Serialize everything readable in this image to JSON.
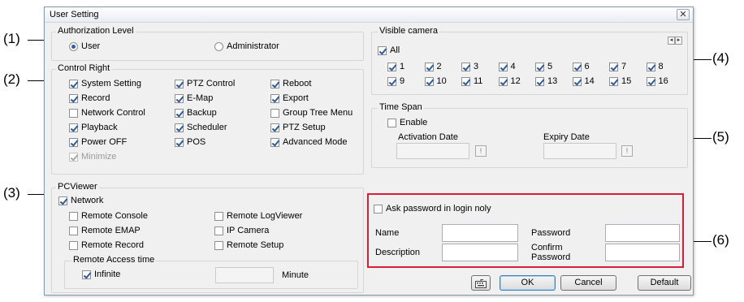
{
  "callouts": [
    "(1)",
    "(2)",
    "(3)",
    "(4)",
    "(5)",
    "(6)"
  ],
  "dialog": {
    "title": "User Setting",
    "close_glyph": "✕"
  },
  "authorization": {
    "label": "Authorization Level",
    "options": [
      {
        "label": "User",
        "selected": true
      },
      {
        "label": "Administrator",
        "selected": false
      }
    ]
  },
  "control_right": {
    "label": "Control Right",
    "items": [
      {
        "label": "System Setting",
        "checked": true,
        "disabled": false
      },
      {
        "label": "PTZ Control",
        "checked": true,
        "disabled": false
      },
      {
        "label": "Reboot",
        "checked": true,
        "disabled": false
      },
      {
        "label": "Record",
        "checked": true,
        "disabled": false
      },
      {
        "label": "E-Map",
        "checked": true,
        "disabled": false
      },
      {
        "label": "Export",
        "checked": true,
        "disabled": false
      },
      {
        "label": "Network Control",
        "checked": false,
        "disabled": false
      },
      {
        "label": "Backup",
        "checked": true,
        "disabled": false
      },
      {
        "label": "Group Tree Menu",
        "checked": false,
        "disabled": false
      },
      {
        "label": "Playback",
        "checked": true,
        "disabled": false
      },
      {
        "label": "Scheduler",
        "checked": true,
        "disabled": false
      },
      {
        "label": "PTZ Setup",
        "checked": true,
        "disabled": false
      },
      {
        "label": "Power OFF",
        "checked": true,
        "disabled": false
      },
      {
        "label": "POS",
        "checked": true,
        "disabled": false
      },
      {
        "label": "Advanced Mode",
        "checked": true,
        "disabled": false
      },
      {
        "label": "Minimize",
        "checked": true,
        "disabled": true
      }
    ]
  },
  "pcviewer": {
    "label": "PCViewer",
    "network": {
      "label": "Network",
      "checked": true
    },
    "items": [
      {
        "label": "Remote Console",
        "checked": false
      },
      {
        "label": "Remote LogViewer",
        "checked": false
      },
      {
        "label": "Remote EMAP",
        "checked": false
      },
      {
        "label": "IP Camera",
        "checked": false
      },
      {
        "label": "Remote Record",
        "checked": false
      },
      {
        "label": "Remote Setup",
        "checked": false
      }
    ],
    "access_time": {
      "label": "Remote Access time",
      "infinite_label": "Infinite",
      "infinite_checked": true,
      "minutes_value": "",
      "unit": "Minute"
    }
  },
  "visible_camera": {
    "label": "Visible camera",
    "all_label": "All",
    "all_checked": true,
    "prev_glyph": "◂",
    "next_glyph": "▸",
    "cameras": [
      "1",
      "2",
      "3",
      "4",
      "5",
      "6",
      "7",
      "8",
      "9",
      "10",
      "11",
      "12",
      "13",
      "14",
      "15",
      "16"
    ]
  },
  "time_span": {
    "label": "Time Span",
    "enable_label": "Enable",
    "enable_checked": false,
    "activation_label": "Activation Date",
    "expiry_label": "Expiry Date",
    "activation_value": "",
    "expiry_value": "",
    "picker_glyph": "!"
  },
  "account": {
    "ask_password_label": "Ask password in login noly",
    "ask_password_checked": false,
    "name_label": "Name",
    "password_label": "Password",
    "description_label": "Description",
    "confirm_label_line1": "Confirm",
    "confirm_label_line2": "Password",
    "name_value": "",
    "password_value": "",
    "description_value": "",
    "confirm_value": ""
  },
  "buttons": {
    "keyboard_icon": "keyboard-icon",
    "ok": "OK",
    "cancel": "Cancel",
    "default": "Default"
  },
  "colors": {
    "highlight_box": "#d6203a",
    "check_mark": "#2c5aa0"
  }
}
